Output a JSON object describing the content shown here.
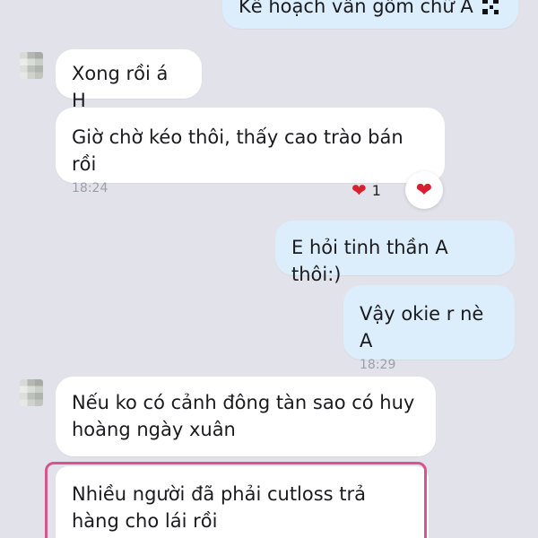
{
  "messages": [
    {
      "text": "Kế hoạch vẫn gồm chữ A"
    },
    {
      "text": "Xong rồi á H"
    },
    {
      "text": "Giờ chờ kéo thôi, thấy cao trào bán rồi",
      "time": "18:24",
      "reaction": {
        "icon": "heart-icon",
        "count": "1"
      }
    },
    {
      "text": "E hỏi tinh thần A thôi:)"
    },
    {
      "text": "Vậy okie r nè A",
      "time": "18:29"
    },
    {
      "text": "Nếu ko có cảnh đông tàn sao có huy hoàng ngày xuân"
    },
    {
      "text": "Nhiều người đã phải cutloss trả hàng cho lái rồi"
    }
  ],
  "colors": {
    "background": "#e2e3ea",
    "incoming_bubble": "#ffffff",
    "outgoing_bubble": "#dcedfb",
    "highlight": "#d9538f",
    "heart": "#d9202f"
  }
}
